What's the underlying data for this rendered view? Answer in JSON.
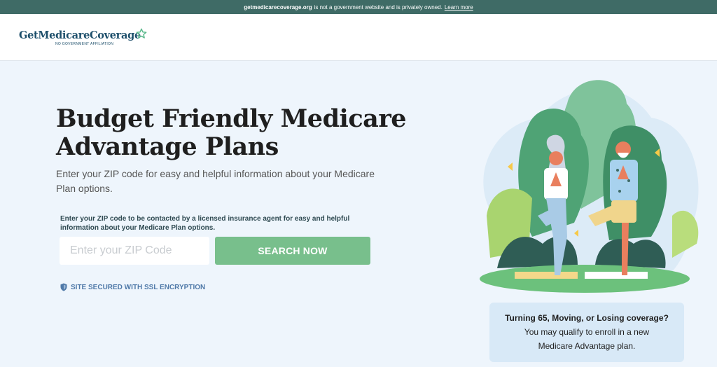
{
  "topbar": {
    "domain": "getmedicarecoverage.org",
    "notice": "is not a government website and is privately owned.",
    "link": "Learn more"
  },
  "header": {
    "logo_text": "GetMedicareCoverage",
    "logo_subtext": "NO GOVERNMENT AFFILIATION"
  },
  "hero": {
    "title": "Budget Friendly Medicare Advantage Plans",
    "subtitle": "Enter your ZIP code for easy and helpful information about your Medicare Plan options."
  },
  "form": {
    "note": "Enter your ZIP code to be contacted by a licensed insurance agent for easy and helpful information about your Medicare Plan options.",
    "zip_placeholder": "Enter your ZIP Code",
    "zip_value": "",
    "button_label": "SEARCH NOW",
    "ssl_text": "SITE SECURED WITH SSL ENCRYPTION"
  },
  "callout": {
    "line1": "Turning 65, Moving, or Losing coverage?",
    "line2": "You may qualify to enroll in a new",
    "line3": "Medicare Advantage plan."
  },
  "colors": {
    "topbar": "#3f6b66",
    "accent_green": "#78bf8c",
    "brand_blue": "#1d4f6b",
    "page_bg": "#eef5fc",
    "callout_bg": "#d8e9f7"
  },
  "icons": [
    "star-icon",
    "shield-icon",
    "yoga-couple-illustration"
  ]
}
